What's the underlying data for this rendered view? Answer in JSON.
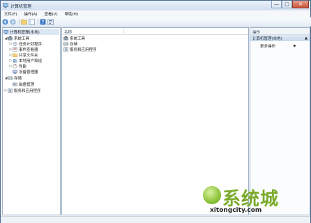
{
  "window": {
    "title": "计算机管理",
    "minimize_glyph": "—",
    "maximize_glyph": "□",
    "close_glyph": "✕"
  },
  "menu": [
    "文件(F)",
    "操作(A)",
    "查看(V)",
    "帮助(H)"
  ],
  "toolbar": {
    "icons": [
      "back-arrow-icon",
      "forward-arrow-icon",
      "up-folder-icon",
      "show-tree-icon",
      "help-icon",
      "properties-icon"
    ]
  },
  "tree": {
    "root": "计算机管理(本地)",
    "system_tools": "系统工具",
    "task_scheduler": "任务计划程序",
    "event_viewer": "事件查看器",
    "shared_folders": "共享文件夹",
    "local_users": "本地用户和组",
    "performance": "性能",
    "device_manager": "设备管理器",
    "storage": "存储",
    "disk_management": "磁盘管理",
    "services_apps": "服务和应用程序"
  },
  "center": {
    "column_name": "名称",
    "items": [
      "系统工具",
      "存储",
      "服务和应用程序"
    ]
  },
  "actions": {
    "header": "操作",
    "section": "计算机管理(本地)",
    "more": "更多操作",
    "section_arrow": "▲",
    "more_arrow": "▶"
  },
  "watermark": {
    "brand": "系统城",
    "url": "xitongcity.com"
  },
  "colors": {
    "selection": "#dbe7f4",
    "pane_border": "#9fb2c8",
    "watermark_green": "#7aaa2a"
  }
}
